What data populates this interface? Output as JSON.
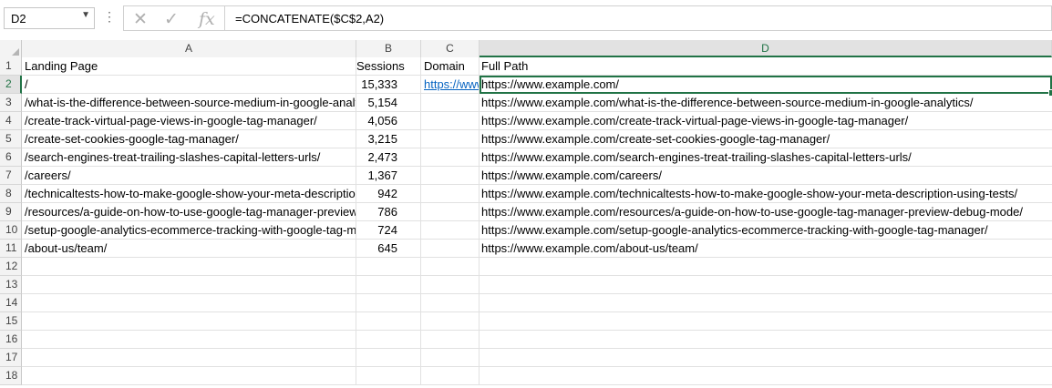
{
  "formula_bar": {
    "name_box": "D2",
    "formula": "=CONCATENATE($C$2,A2)",
    "fx_label": "fx",
    "cancel_icon": "✕",
    "enter_icon": "✓"
  },
  "columns": [
    "A",
    "B",
    "C",
    "D"
  ],
  "row_numbers": [
    "1",
    "2",
    "3",
    "4",
    "5",
    "6",
    "7",
    "8",
    "9",
    "10",
    "11",
    "12",
    "13",
    "14",
    "15",
    "16",
    "17",
    "18"
  ],
  "rows": [
    {
      "A": "Landing Page",
      "B": "Sessions",
      "C": "Domain",
      "D": "Full Path"
    },
    {
      "A": "/",
      "B": "15,333",
      "C": "https://www.example.com",
      "D": "https://www.example.com/"
    },
    {
      "A": "/what-is-the-difference-between-source-medium-in-google-analytics/",
      "B": "5,154",
      "C": "",
      "D": "https://www.example.com/what-is-the-difference-between-source-medium-in-google-analytics/"
    },
    {
      "A": "/create-track-virtual-page-views-in-google-tag-manager/",
      "B": "4,056",
      "C": "",
      "D": "https://www.example.com/create-track-virtual-page-views-in-google-tag-manager/"
    },
    {
      "A": "/create-set-cookies-google-tag-manager/",
      "B": "3,215",
      "C": "",
      "D": "https://www.example.com/create-set-cookies-google-tag-manager/"
    },
    {
      "A": "/search-engines-treat-trailing-slashes-capital-letters-urls/",
      "B": "2,473",
      "C": "",
      "D": "https://www.example.com/search-engines-treat-trailing-slashes-capital-letters-urls/"
    },
    {
      "A": "/careers/",
      "B": "1,367",
      "C": "",
      "D": "https://www.example.com/careers/"
    },
    {
      "A": "/technicaltests-how-to-make-google-show-your-meta-description-using-tests/",
      "B": "942",
      "C": "",
      "D": "https://www.example.com/technicaltests-how-to-make-google-show-your-meta-description-using-tests/"
    },
    {
      "A": "/resources/a-guide-on-how-to-use-google-tag-manager-preview-debug-mode/",
      "B": "786",
      "C": "",
      "D": "https://www.example.com/resources/a-guide-on-how-to-use-google-tag-manager-preview-debug-mode/"
    },
    {
      "A": "/setup-google-analytics-ecommerce-tracking-with-google-tag-manager/",
      "B": "724",
      "C": "",
      "D": "https://www.example.com/setup-google-analytics-ecommerce-tracking-with-google-tag-manager/"
    },
    {
      "A": "/about-us/team/",
      "B": "645",
      "C": "",
      "D": "https://www.example.com/about-us/team/"
    },
    {
      "A": "",
      "B": "",
      "C": "",
      "D": ""
    },
    {
      "A": "",
      "B": "",
      "C": "",
      "D": ""
    },
    {
      "A": "",
      "B": "",
      "C": "",
      "D": ""
    },
    {
      "A": "",
      "B": "",
      "C": "",
      "D": ""
    },
    {
      "A": "",
      "B": "",
      "C": "",
      "D": ""
    },
    {
      "A": "",
      "B": "",
      "C": "",
      "D": ""
    },
    {
      "A": "",
      "B": "",
      "C": "",
      "D": ""
    }
  ],
  "selection": {
    "cell": "D2",
    "column": "D",
    "row": "2"
  },
  "colors": {
    "accent": "#217346",
    "link": "#0563c1"
  }
}
